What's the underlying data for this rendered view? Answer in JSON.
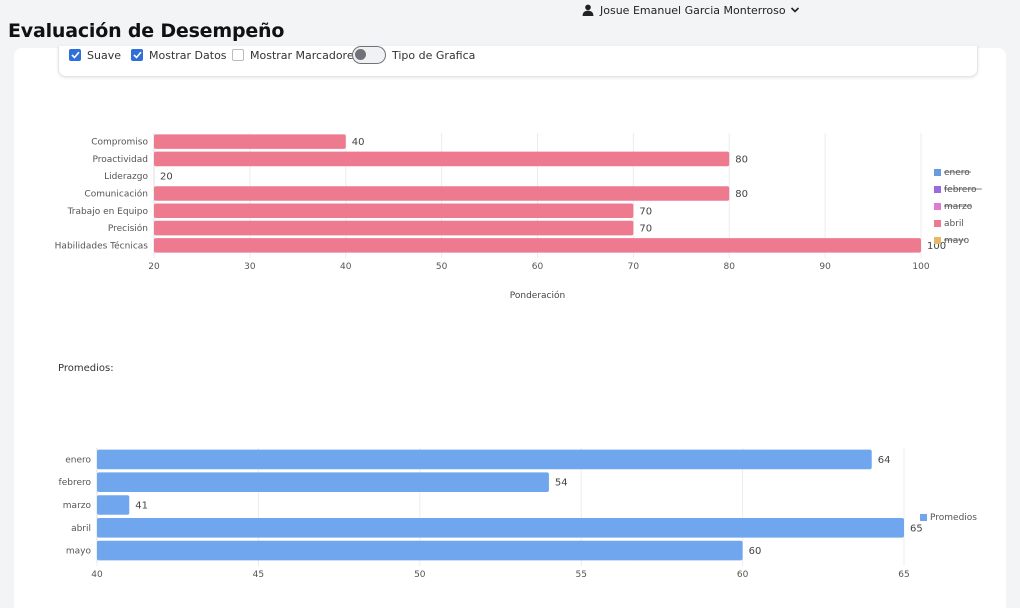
{
  "header": {
    "title": "Evaluación de Desempeño",
    "user_name": "Josue Emanuel Garcia Monterroso"
  },
  "options": {
    "smooth_label": "Suave",
    "smooth_checked": true,
    "show_data_label": "Mostrar Datos",
    "show_data_checked": true,
    "show_markers_label": "Mostrar Marcadores",
    "show_markers_checked": false,
    "chart_type_label": "Tipo de Grafica",
    "chart_type_on": false
  },
  "averages_label": "Promedios:",
  "chart_data": [
    {
      "type": "bar",
      "orientation": "horizontal",
      "categories": [
        "Compromiso",
        "Proactividad",
        "Liderazgo",
        "Comunicación",
        "Trabajo en Equipo",
        "Precisión",
        "Habilidades Técnicas"
      ],
      "series": [
        {
          "name": "enero",
          "color": "#6a9be0",
          "hidden": true,
          "values": []
        },
        {
          "name": "febrero",
          "color": "#9b6ae0",
          "hidden": true,
          "values": []
        },
        {
          "name": "marzo",
          "color": "#e07ad8",
          "hidden": true,
          "values": []
        },
        {
          "name": "abril",
          "color": "#ee7a90",
          "hidden": false,
          "values": [
            40,
            80,
            20,
            80,
            70,
            70,
            100
          ]
        },
        {
          "name": "mayo",
          "color": "#e8b86a",
          "hidden": true,
          "values": []
        }
      ],
      "xlabel": "Ponderación",
      "xlim": [
        20,
        100
      ],
      "xticks": [
        20,
        30,
        40,
        50,
        60,
        70,
        80,
        90,
        100
      ],
      "grid": true,
      "show_data_labels": true,
      "legend_position": "right"
    },
    {
      "type": "bar",
      "orientation": "horizontal",
      "categories": [
        "enero",
        "febrero",
        "marzo",
        "abril",
        "mayo"
      ],
      "series": [
        {
          "name": "Promedios",
          "color": "#6fa6ee",
          "values": [
            64,
            54,
            41,
            65,
            60
          ]
        }
      ],
      "xlim": [
        40,
        65
      ],
      "xticks": [
        40,
        45,
        50,
        55,
        60,
        65
      ],
      "grid": true,
      "show_data_labels": true,
      "legend_position": "right"
    }
  ]
}
